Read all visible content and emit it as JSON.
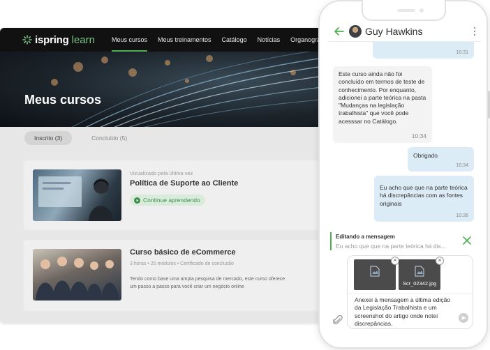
{
  "app": {
    "logo_main": "ispring",
    "logo_accent": "learn",
    "nav": [
      "Meus cursos",
      "Meus treinamentos",
      "Catálogo",
      "Notícias",
      "Organograma"
    ],
    "hero_title": "Meus cursos",
    "tabs": [
      "Inscrito (3)",
      "Concluído (5)"
    ],
    "courses": [
      {
        "meta": "Vizualizado pela última vez",
        "title": "Política de Suporte ao Cliente",
        "action": "Continue aprendendo"
      },
      {
        "title": "Curso básico de eCommerce",
        "meta": "3 horas • 25 módulos  •  Certificado de conclusão",
        "description": "Tendo como base uma ampla pesquisa de mercado, este curso oferece um passo a passo para você criar um negócio online"
      }
    ]
  },
  "chat": {
    "contact": "Guy Hawkins",
    "messages": [
      {
        "direction": "out",
        "text": "",
        "time": "10:31"
      },
      {
        "direction": "in",
        "text": "Este curso ainda não foi concluído em termos de teste de conhecimento. Por enquanto, adicionei a parte teórica na pasta \"Mudanças na legislação trabalhista\" que você pode acesssar no Catálogo.",
        "time": "10:34"
      },
      {
        "direction": "out",
        "text": "Obrigado",
        "time": "10:34"
      },
      {
        "direction": "out",
        "text": "Eu acho que que na parte teórica há discrepâncias com as fontes originais",
        "time": "10:36"
      }
    ],
    "editing": {
      "label": "Editando a mensagem",
      "preview": "Eu acho que que na parte teórica há dis..."
    },
    "attachments": [
      {
        "name": ""
      },
      {
        "name": "Scr_02342.jpg"
      }
    ],
    "composer_text": "Anexei à mensagem a última edição da Legislação Trabalhista e um screenshot do artigo onde notei discrepâncias."
  },
  "colors": {
    "accent_green": "#4caf50",
    "bubble_out": "#dcecf7",
    "bubble_in": "#f3f3f3"
  }
}
